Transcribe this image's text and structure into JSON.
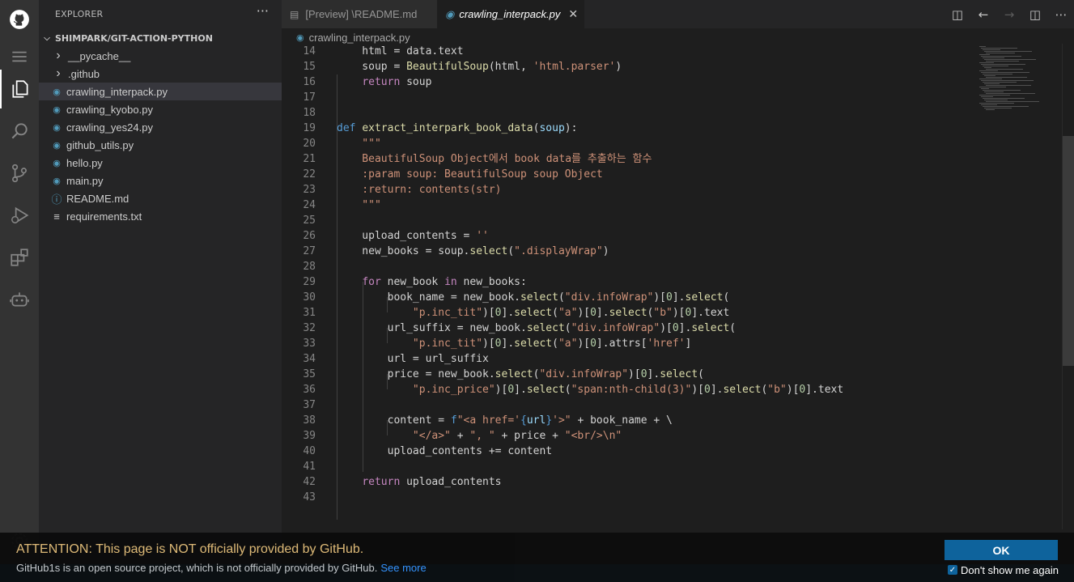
{
  "sidebar": {
    "title": "EXPLORER",
    "more": "···",
    "section": "SHIMPARK/GIT-ACTION-PYTHON",
    "items": [
      {
        "label": "__pycache__",
        "kind": "folder"
      },
      {
        "label": ".github",
        "kind": "folder"
      },
      {
        "label": "crawling_interpack.py",
        "kind": "python",
        "selected": true
      },
      {
        "label": "crawling_kyobo.py",
        "kind": "python"
      },
      {
        "label": "crawling_yes24.py",
        "kind": "python"
      },
      {
        "label": "github_utils.py",
        "kind": "python"
      },
      {
        "label": "hello.py",
        "kind": "python"
      },
      {
        "label": "main.py",
        "kind": "python"
      },
      {
        "label": "README.md",
        "kind": "info"
      },
      {
        "label": "requirements.txt",
        "kind": "text"
      }
    ]
  },
  "tabs": [
    {
      "label": "[Preview] \\README.md",
      "active": false
    },
    {
      "label": "crawling_interpack.py",
      "active": true,
      "close": "✕"
    }
  ],
  "breadcrumb": "crawling_interpack.py",
  "code": [
    {
      "n": "14",
      "t": [
        [
          "",
          "    html = data.text"
        ]
      ]
    },
    {
      "n": "15",
      "t": [
        [
          "",
          "    soup = "
        ],
        [
          "fn",
          "BeautifulSoup"
        ],
        [
          "",
          "(html, "
        ],
        [
          "str",
          "'html.parser'"
        ],
        [
          "",
          ")"
        ]
      ]
    },
    {
      "n": "16",
      "t": [
        [
          "",
          "    "
        ],
        [
          "kwc",
          "return"
        ],
        [
          "",
          " soup"
        ]
      ]
    },
    {
      "n": "17",
      "t": []
    },
    {
      "n": "18",
      "t": []
    },
    {
      "n": "19",
      "t": [
        [
          "kw",
          "def"
        ],
        [
          "",
          " "
        ],
        [
          "fn",
          "extract_interpark_book_data"
        ],
        [
          "",
          "("
        ],
        [
          "prm",
          "soup"
        ],
        [
          "",
          "):"
        ]
      ]
    },
    {
      "n": "20",
      "t": [
        [
          "str",
          "    \"\"\""
        ]
      ]
    },
    {
      "n": "21",
      "t": [
        [
          "str",
          "    BeautifulSoup Object에서 book data를 추출하는 함수"
        ]
      ]
    },
    {
      "n": "22",
      "t": [
        [
          "str",
          "    :param soup: BeautifulSoup soup Object"
        ]
      ]
    },
    {
      "n": "23",
      "t": [
        [
          "str",
          "    :return: contents(str)"
        ]
      ]
    },
    {
      "n": "24",
      "t": [
        [
          "str",
          "    \"\"\""
        ]
      ]
    },
    {
      "n": "25",
      "t": []
    },
    {
      "n": "26",
      "t": [
        [
          "",
          "    upload_contents = "
        ],
        [
          "str",
          "''"
        ]
      ]
    },
    {
      "n": "27",
      "t": [
        [
          "",
          "    new_books = soup."
        ],
        [
          "fn",
          "select"
        ],
        [
          "",
          "("
        ],
        [
          "str",
          "\".displayWrap\""
        ],
        [
          "",
          ")"
        ]
      ]
    },
    {
      "n": "28",
      "t": []
    },
    {
      "n": "29",
      "t": [
        [
          "",
          "    "
        ],
        [
          "kwc",
          "for"
        ],
        [
          "",
          " new_book "
        ],
        [
          "kwc",
          "in"
        ],
        [
          "",
          " new_books:"
        ]
      ]
    },
    {
      "n": "30",
      "t": [
        [
          "",
          "        book_name = new_book."
        ],
        [
          "fn",
          "select"
        ],
        [
          "",
          "("
        ],
        [
          "str",
          "\"div.infoWrap\""
        ],
        [
          "",
          ")["
        ],
        [
          "num",
          "0"
        ],
        [
          "",
          "]."
        ],
        [
          "fn",
          "select"
        ],
        [
          "",
          "("
        ]
      ]
    },
    {
      "n": "31",
      "t": [
        [
          "",
          "            "
        ],
        [
          "str",
          "\"p.inc_tit\""
        ],
        [
          "",
          ")["
        ],
        [
          "num",
          "0"
        ],
        [
          "",
          "]."
        ],
        [
          "fn",
          "select"
        ],
        [
          "",
          "("
        ],
        [
          "str",
          "\"a\""
        ],
        [
          "",
          ")["
        ],
        [
          "num",
          "0"
        ],
        [
          "",
          "]."
        ],
        [
          "fn",
          "select"
        ],
        [
          "",
          "("
        ],
        [
          "str",
          "\"b\""
        ],
        [
          "",
          ")["
        ],
        [
          "num",
          "0"
        ],
        [
          "",
          "].text"
        ]
      ]
    },
    {
      "n": "32",
      "t": [
        [
          "",
          "        url_suffix = new_book."
        ],
        [
          "fn",
          "select"
        ],
        [
          "",
          "("
        ],
        [
          "str",
          "\"div.infoWrap\""
        ],
        [
          "",
          ")["
        ],
        [
          "num",
          "0"
        ],
        [
          "",
          "]."
        ],
        [
          "fn",
          "select"
        ],
        [
          "",
          "("
        ]
      ]
    },
    {
      "n": "33",
      "t": [
        [
          "",
          "            "
        ],
        [
          "str",
          "\"p.inc_tit\""
        ],
        [
          "",
          ")["
        ],
        [
          "num",
          "0"
        ],
        [
          "",
          "]."
        ],
        [
          "fn",
          "select"
        ],
        [
          "",
          "("
        ],
        [
          "str",
          "\"a\""
        ],
        [
          "",
          ")["
        ],
        [
          "num",
          "0"
        ],
        [
          "",
          "].attrs["
        ],
        [
          "str",
          "'href'"
        ],
        [
          "",
          "]"
        ]
      ]
    },
    {
      "n": "34",
      "t": [
        [
          "",
          "        url = url_suffix"
        ]
      ]
    },
    {
      "n": "35",
      "t": [
        [
          "",
          "        price = new_book."
        ],
        [
          "fn",
          "select"
        ],
        [
          "",
          "("
        ],
        [
          "str",
          "\"div.infoWrap\""
        ],
        [
          "",
          ")["
        ],
        [
          "num",
          "0"
        ],
        [
          "",
          "]."
        ],
        [
          "fn",
          "select"
        ],
        [
          "",
          "("
        ]
      ]
    },
    {
      "n": "36",
      "t": [
        [
          "",
          "            "
        ],
        [
          "str",
          "\"p.inc_price\""
        ],
        [
          "",
          ")["
        ],
        [
          "num",
          "0"
        ],
        [
          "",
          "]."
        ],
        [
          "fn",
          "select"
        ],
        [
          "",
          "("
        ],
        [
          "str",
          "\"span:nth-child(3)\""
        ],
        [
          "",
          ")["
        ],
        [
          "num",
          "0"
        ],
        [
          "",
          "]."
        ],
        [
          "fn",
          "select"
        ],
        [
          "",
          "("
        ],
        [
          "str",
          "\"b\""
        ],
        [
          "",
          ")["
        ],
        [
          "num",
          "0"
        ],
        [
          "",
          "].text"
        ]
      ]
    },
    {
      "n": "37",
      "t": []
    },
    {
      "n": "38",
      "t": [
        [
          "",
          "        content = "
        ],
        [
          "kw",
          "f"
        ],
        [
          "str",
          "\"<a href='"
        ],
        [
          "kw",
          "{"
        ],
        [
          "prm",
          "url"
        ],
        [
          "kw",
          "}"
        ],
        [
          "str",
          "'>\""
        ],
        [
          "",
          " + book_name + \\"
        ]
      ]
    },
    {
      "n": "39",
      "t": [
        [
          "",
          "            "
        ],
        [
          "str",
          "\"</a>\""
        ],
        [
          "",
          " + "
        ],
        [
          "str",
          "\", \""
        ],
        [
          "",
          " + price + "
        ],
        [
          "str",
          "\"<br/>\\n\""
        ]
      ]
    },
    {
      "n": "40",
      "t": [
        [
          "",
          "        upload_contents += content"
        ]
      ]
    },
    {
      "n": "41",
      "t": []
    },
    {
      "n": "42",
      "t": [
        [
          "",
          "    "
        ],
        [
          "kwc",
          "return"
        ],
        [
          "",
          " upload_contents"
        ]
      ]
    },
    {
      "n": "43",
      "t": []
    }
  ],
  "banner": {
    "title": "ATTENTION: This page is NOT officially provided by GitHub.",
    "text": "GitHub1s is an open source project, which is not officially provided by GitHub.",
    "link": "See more",
    "ok": "OK",
    "dont_show": "Don't show me again",
    "dont_show_checked": true
  },
  "colors": {
    "activity_bar": "#333333",
    "sidebar": "#252526",
    "editor": "#1e1e1e",
    "status_bar": "#007acc",
    "ok_button": "#0e639c",
    "banner_title": "#e5c07b"
  }
}
